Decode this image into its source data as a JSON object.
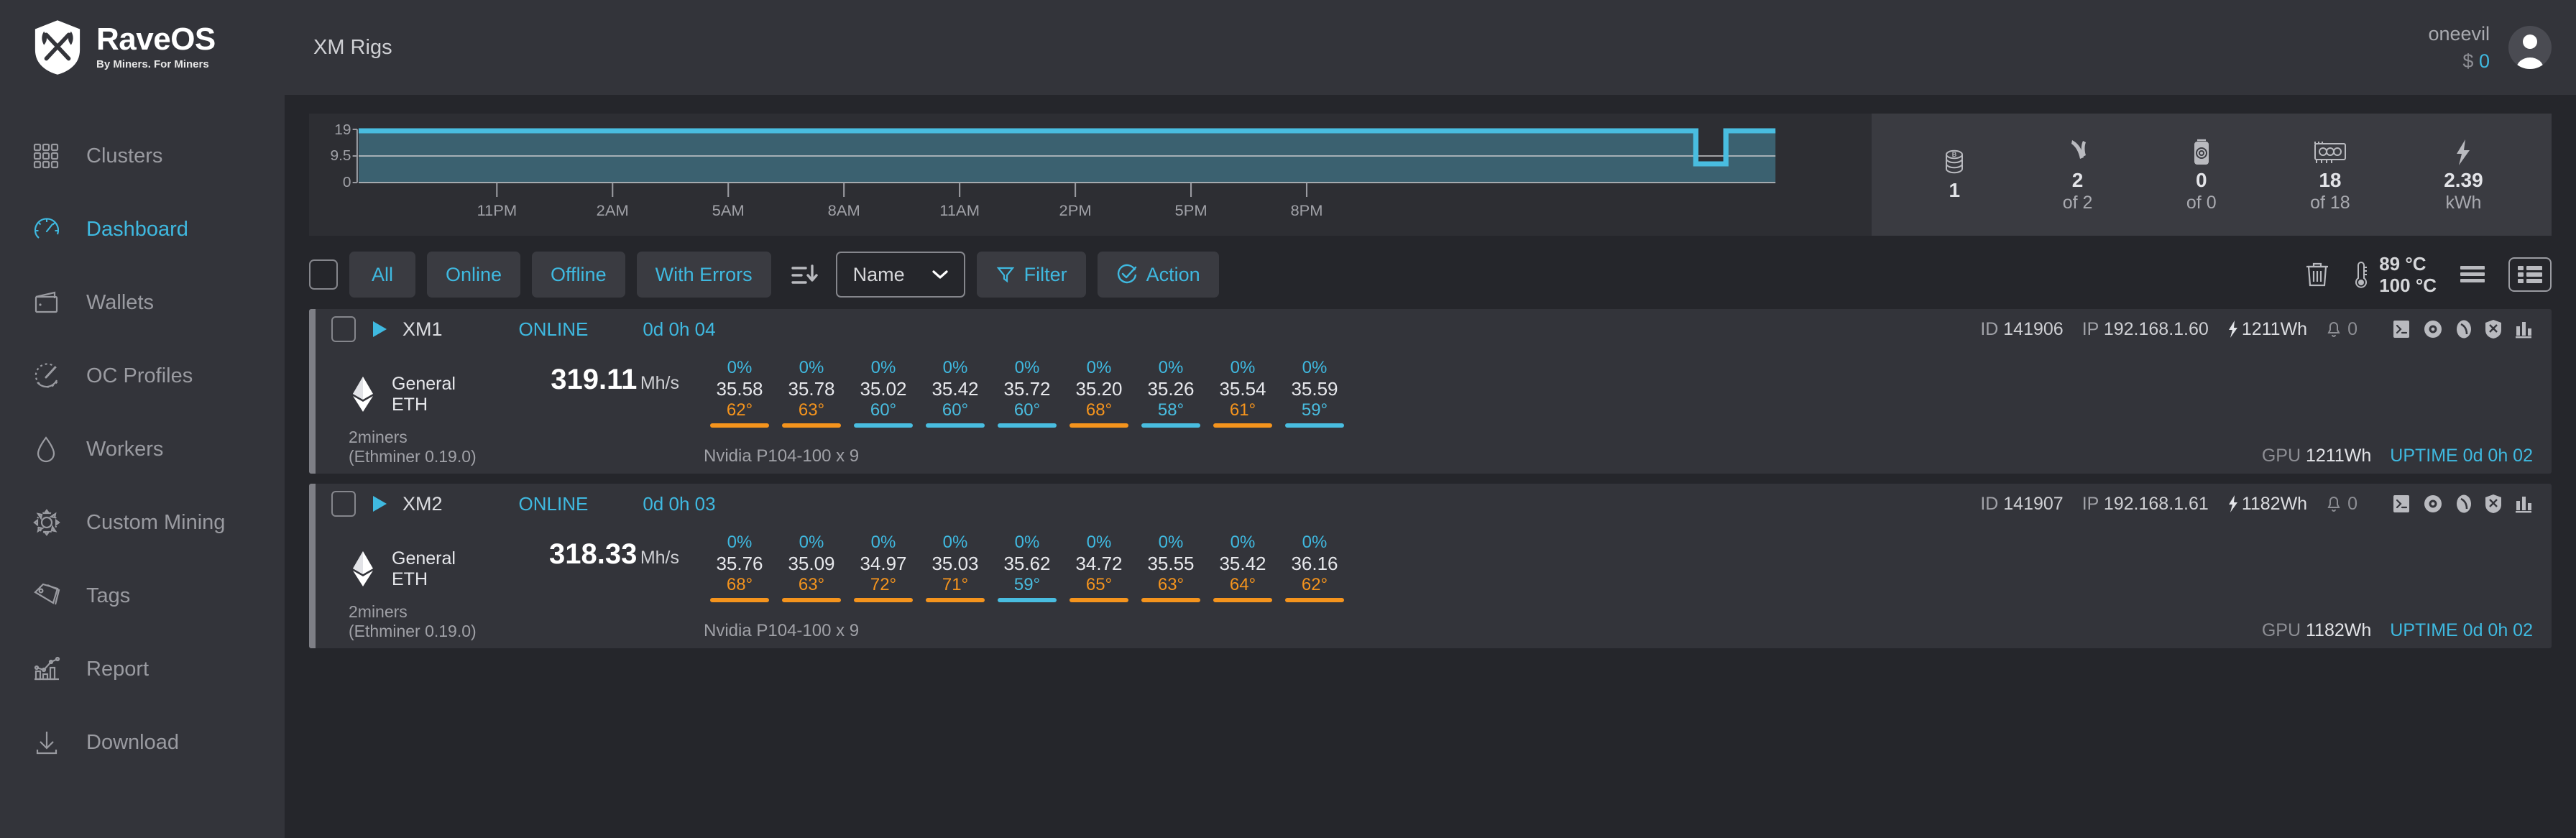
{
  "brand": {
    "name": "RaveOS",
    "tagline": "By Miners. For Miners"
  },
  "header": {
    "title": "XM Rigs",
    "user_name": "oneevil",
    "currency_symbol": "$",
    "balance": "0"
  },
  "sidebar": {
    "items": [
      {
        "label": "Clusters",
        "icon": "grid-icon",
        "active": false
      },
      {
        "label": "Dashboard",
        "icon": "gauge-icon",
        "active": true
      },
      {
        "label": "Wallets",
        "icon": "wallet-icon",
        "active": false
      },
      {
        "label": "OC Profiles",
        "icon": "speedometer-icon",
        "active": false
      },
      {
        "label": "Workers",
        "icon": "droplet-icon",
        "active": false
      },
      {
        "label": "Custom Mining",
        "icon": "gear-icon",
        "active": false
      },
      {
        "label": "Tags",
        "icon": "tag-icon",
        "active": false
      },
      {
        "label": "Report",
        "icon": "chart-icon",
        "active": false
      },
      {
        "label": "Download",
        "icon": "download-icon",
        "active": false
      }
    ]
  },
  "stats": [
    {
      "icon": "coins-icon",
      "value": "1",
      "sub": ""
    },
    {
      "icon": "pickaxe-icon",
      "value": "2",
      "sub": "of 2"
    },
    {
      "icon": "asic-icon",
      "value": "0",
      "sub": "of 0"
    },
    {
      "icon": "gpu-card-icon",
      "value": "18",
      "sub": "of 18"
    },
    {
      "icon": "bolt-icon",
      "value": "2.39",
      "sub": "kWh"
    }
  ],
  "chart_data": {
    "type": "area",
    "title": "",
    "xlabel": "",
    "ylabel": "",
    "ylim": [
      0,
      19
    ],
    "ytick_labels": [
      "19",
      "9.5",
      "0"
    ],
    "ytick_values": [
      19,
      9.5,
      0
    ],
    "xtick_labels": [
      "11PM",
      "2AM",
      "5AM",
      "8AM",
      "11AM",
      "2PM",
      "5PM",
      "8PM"
    ],
    "grid": true,
    "legend": "none",
    "line_color": "#49bde0",
    "fill_color": "#3b6170",
    "series": [
      {
        "name": "Online GPUs",
        "x": [
          "10PM",
          "11PM",
          "12AM",
          "1AM",
          "2AM",
          "3AM",
          "4AM",
          "5AM",
          "6AM",
          "7AM",
          "8AM",
          "9AM",
          "10AM",
          "11AM",
          "12PM",
          "1PM",
          "2PM",
          "3PM",
          "4PM",
          "5PM",
          "6PM",
          "7PM",
          "8PM",
          "9PM",
          "9:30PM",
          "10PM"
        ],
        "values": [
          18,
          18,
          18,
          18,
          18,
          18,
          18,
          18,
          18,
          18,
          18,
          18,
          18,
          18,
          18,
          18,
          18,
          18,
          18,
          18,
          18,
          18,
          18,
          18,
          9,
          18
        ]
      }
    ]
  },
  "toolbar": {
    "select_all_label": "",
    "filters": [
      {
        "label": "All"
      },
      {
        "label": "Online"
      },
      {
        "label": "Offline"
      },
      {
        "label": "With Errors"
      }
    ],
    "sort_select_value": "Name",
    "filter_label": "Filter",
    "action_label": "Action",
    "temp_warn": "89 °C",
    "temp_crit": "100 °C"
  },
  "rigs": [
    {
      "name": "XM1",
      "status": "ONLINE",
      "uptime_top": "0d 0h 04",
      "id_label": "ID",
      "id": "141906",
      "ip_label": "IP",
      "ip": "192.168.1.60",
      "wh": "1211Wh",
      "alerts": "0",
      "coin_name": "General",
      "coin_ticker": "ETH",
      "hashrate": "319.11",
      "hash_unit": "Mh/s",
      "pool": "2miners",
      "miner": "(Ethminer 0.19.0)",
      "gpu_model": "Nvidia P104-100 x 9",
      "gpu_total_label": "GPU",
      "gpu_total": "1211Wh",
      "uptime_label": "UPTIME",
      "uptime": "0d 0h 02",
      "gpus": [
        {
          "pct": "0%",
          "hashrate": "35.58",
          "temp": "62°",
          "state": "warn"
        },
        {
          "pct": "0%",
          "hashrate": "35.78",
          "temp": "63°",
          "state": "warn"
        },
        {
          "pct": "0%",
          "hashrate": "35.02",
          "temp": "60°",
          "state": "ok"
        },
        {
          "pct": "0%",
          "hashrate": "35.42",
          "temp": "60°",
          "state": "ok"
        },
        {
          "pct": "0%",
          "hashrate": "35.72",
          "temp": "60°",
          "state": "ok"
        },
        {
          "pct": "0%",
          "hashrate": "35.20",
          "temp": "68°",
          "state": "warn"
        },
        {
          "pct": "0%",
          "hashrate": "35.26",
          "temp": "58°",
          "state": "ok"
        },
        {
          "pct": "0%",
          "hashrate": "35.54",
          "temp": "61°",
          "state": "warn"
        },
        {
          "pct": "0%",
          "hashrate": "35.59",
          "temp": "59°",
          "state": "ok"
        }
      ]
    },
    {
      "name": "XM2",
      "status": "ONLINE",
      "uptime_top": "0d 0h 03",
      "id_label": "ID",
      "id": "141907",
      "ip_label": "IP",
      "ip": "192.168.1.61",
      "wh": "1182Wh",
      "alerts": "0",
      "coin_name": "General",
      "coin_ticker": "ETH",
      "hashrate": "318.33",
      "hash_unit": "Mh/s",
      "pool": "2miners",
      "miner": "(Ethminer 0.19.0)",
      "gpu_model": "Nvidia P104-100 x 9",
      "gpu_total_label": "GPU",
      "gpu_total": "1182Wh",
      "uptime_label": "UPTIME",
      "uptime": "0d 0h 02",
      "gpus": [
        {
          "pct": "0%",
          "hashrate": "35.76",
          "temp": "68°",
          "state": "warn"
        },
        {
          "pct": "0%",
          "hashrate": "35.09",
          "temp": "63°",
          "state": "warn"
        },
        {
          "pct": "0%",
          "hashrate": "34.97",
          "temp": "72°",
          "state": "warn"
        },
        {
          "pct": "0%",
          "hashrate": "35.03",
          "temp": "71°",
          "state": "warn"
        },
        {
          "pct": "0%",
          "hashrate": "35.62",
          "temp": "59°",
          "state": "ok"
        },
        {
          "pct": "0%",
          "hashrate": "34.72",
          "temp": "65°",
          "state": "warn"
        },
        {
          "pct": "0%",
          "hashrate": "35.55",
          "temp": "63°",
          "state": "warn"
        },
        {
          "pct": "0%",
          "hashrate": "35.42",
          "temp": "64°",
          "state": "warn"
        },
        {
          "pct": "0%",
          "hashrate": "36.16",
          "temp": "62°",
          "state": "warn"
        }
      ]
    }
  ],
  "colors": {
    "accent": "#3fb9e0",
    "warn": "#f5941d",
    "ok": "#49bde0",
    "bg": "#25262b",
    "panel": "#33343a"
  }
}
